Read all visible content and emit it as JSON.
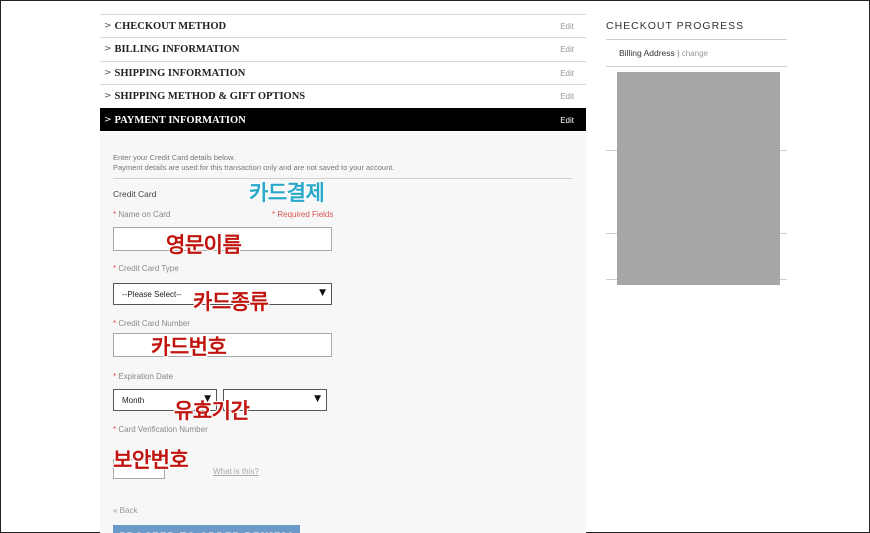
{
  "steps": [
    {
      "label": "CHECKOUT METHOD",
      "edit": "Edit"
    },
    {
      "label": "BILLING INFORMATION",
      "edit": "Edit"
    },
    {
      "label": "SHIPPING INFORMATION",
      "edit": "Edit"
    },
    {
      "label": "SHIPPING METHOD & GIFT OPTIONS",
      "edit": "Edit"
    },
    {
      "label": "PAYMENT INFORMATION",
      "edit": "Edit"
    }
  ],
  "step_caret": ">",
  "payment": {
    "intro_line1": "Enter your Credit Card details below.",
    "intro_line2": "Payment details are used for this transaction only and are not saved to your account.",
    "section_title": "Credit Card",
    "required_star": "*",
    "name_label": "Name on Card",
    "required_note": "* Required Fields",
    "type_label": "Credit Card Type",
    "type_selected": "--Please Select--",
    "number_label": "Credit Card Number",
    "expiry_label": "Expiration Date",
    "expiry_month_selected": "Month",
    "expiry_year_selected": "",
    "cvv_label": "Card Verification Number",
    "whats_this": "What is this?",
    "back_link": "« Back",
    "proceed_button": "PROCEED TO ORDER REVIEW",
    "select_arrow": "▼"
  },
  "annotations": {
    "card_payment": "카드결제",
    "english_name": "영문이름",
    "card_type": "카드종류",
    "card_number": "카드번호",
    "expiry": "유효기간",
    "cvv": "보안번호"
  },
  "progress": {
    "title": "CHECKOUT PROGRESS",
    "billing_address": "Billing Address",
    "separator": "|",
    "change": "change"
  },
  "colors": {
    "active_step_bg": "#000000",
    "proceed_button_bg": "#6b9ac8",
    "annotation_red": "#c0140f",
    "annotation_blue": "#2ba8c8",
    "redaction_gray": "#a6a6a6"
  }
}
